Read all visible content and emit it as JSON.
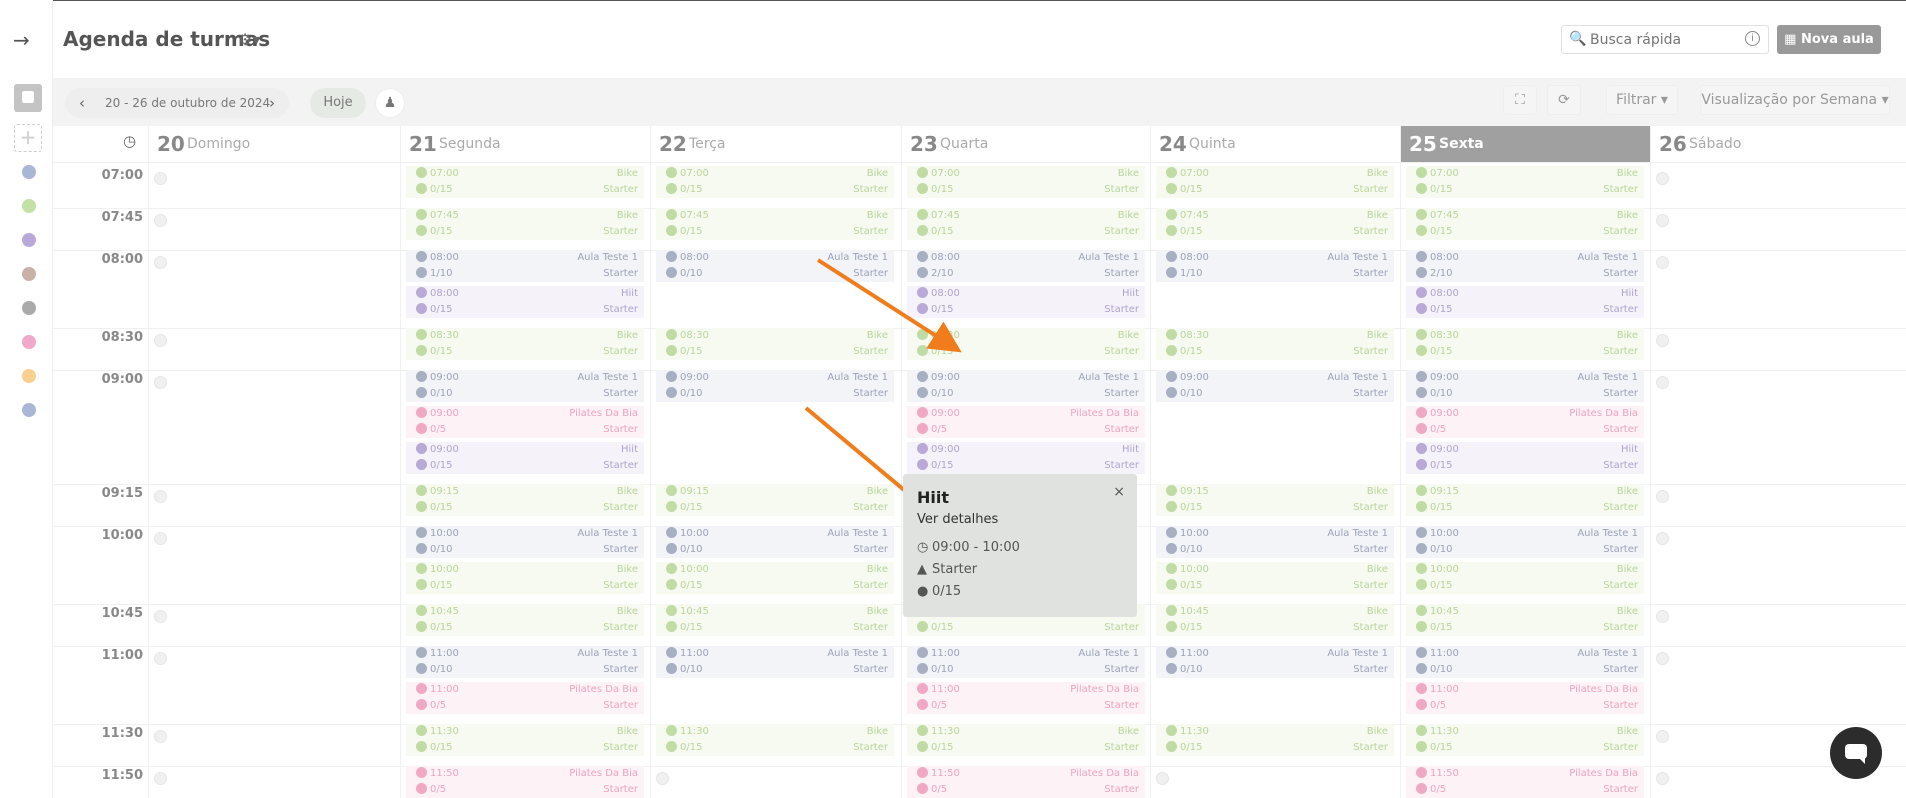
{
  "header": {
    "title": "Agenda de turmas",
    "search_placeholder": "Busca rápida",
    "new_class": "Nova aula"
  },
  "toolbar": {
    "date_range": "20 - 26 de outubro de 2024",
    "today": "Hoje",
    "filter": "Filtrar",
    "view": "Visualização por Semana"
  },
  "sidebar": {
    "colors": [
      "#a9b6d6",
      "#c3e0a6",
      "#b9a9d9",
      "#c8b1a6",
      "#aaaaaa",
      "#f2a9c9",
      "#fbcf8e",
      "#a9b6d6"
    ]
  },
  "days": [
    {
      "num": "20",
      "name": "Domingo"
    },
    {
      "num": "21",
      "name": "Segunda"
    },
    {
      "num": "22",
      "name": "Terça"
    },
    {
      "num": "23",
      "name": "Quarta"
    },
    {
      "num": "24",
      "name": "Quinta"
    },
    {
      "num": "25",
      "name": "Sexta",
      "today": true
    },
    {
      "num": "26",
      "name": "Sábado"
    }
  ],
  "slots": [
    {
      "time": "07:00",
      "cells": [
        [],
        [
          [
            "07:00",
            "0/15",
            "Bike",
            "Starter",
            "green"
          ]
        ],
        [
          [
            "07:00",
            "0/15",
            "Bike",
            "Starter",
            "green"
          ]
        ],
        [
          [
            "07:00",
            "0/15",
            "Bike",
            "Starter",
            "green"
          ]
        ],
        [
          [
            "07:00",
            "0/15",
            "Bike",
            "Starter",
            "green"
          ]
        ],
        [
          [
            "07:00",
            "0/15",
            "Bike",
            "Starter",
            "green"
          ]
        ],
        []
      ]
    },
    {
      "time": "07:45",
      "cells": [
        [],
        [
          [
            "07:45",
            "0/15",
            "Bike",
            "Starter",
            "green"
          ]
        ],
        [
          [
            "07:45",
            "0/15",
            "Bike",
            "Starter",
            "green"
          ]
        ],
        [
          [
            "07:45",
            "0/15",
            "Bike",
            "Starter",
            "green"
          ]
        ],
        [
          [
            "07:45",
            "0/15",
            "Bike",
            "Starter",
            "green"
          ]
        ],
        [
          [
            "07:45",
            "0/15",
            "Bike",
            "Starter",
            "green"
          ]
        ],
        []
      ]
    },
    {
      "time": "08:00",
      "cells": [
        [],
        [
          [
            "08:00",
            "1/10",
            "Aula Teste 1",
            "Starter",
            "blue"
          ],
          [
            "08:00",
            "0/15",
            "Hiit",
            "Starter",
            "purple"
          ]
        ],
        [
          [
            "08:00",
            "0/10",
            "Aula Teste 1",
            "Starter",
            "blue"
          ]
        ],
        [
          [
            "08:00",
            "2/10",
            "Aula Teste 1",
            "Starter",
            "blue"
          ],
          [
            "08:00",
            "0/15",
            "Hiit",
            "Starter",
            "purple"
          ]
        ],
        [
          [
            "08:00",
            "1/10",
            "Aula Teste 1",
            "Starter",
            "blue"
          ]
        ],
        [
          [
            "08:00",
            "2/10",
            "Aula Teste 1",
            "Starter",
            "blue"
          ],
          [
            "08:00",
            "0/15",
            "Hiit",
            "Starter",
            "purple"
          ]
        ],
        []
      ]
    },
    {
      "time": "08:30",
      "cells": [
        [],
        [
          [
            "08:30",
            "0/15",
            "Bike",
            "Starter",
            "green"
          ]
        ],
        [
          [
            "08:30",
            "0/15",
            "Bike",
            "Starter",
            "green"
          ]
        ],
        [
          [
            "08:30",
            "0/15",
            "Bike",
            "Starter",
            "green"
          ]
        ],
        [
          [
            "08:30",
            "0/15",
            "Bike",
            "Starter",
            "green"
          ]
        ],
        [
          [
            "08:30",
            "0/15",
            "Bike",
            "Starter",
            "green"
          ]
        ],
        []
      ]
    },
    {
      "time": "09:00",
      "cells": [
        [],
        [
          [
            "09:00",
            "0/10",
            "Aula Teste 1",
            "Starter",
            "blue"
          ],
          [
            "09:00",
            "0/5",
            "Pilates Da Bia",
            "Starter",
            "pink"
          ],
          [
            "09:00",
            "0/15",
            "Hiit",
            "Starter",
            "purple"
          ]
        ],
        [
          [
            "09:00",
            "0/10",
            "Aula Teste 1",
            "Starter",
            "blue"
          ]
        ],
        [
          [
            "09:00",
            "0/10",
            "Aula Teste 1",
            "Starter",
            "blue"
          ],
          [
            "09:00",
            "0/5",
            "Pilates Da Bia",
            "Starter",
            "pink"
          ],
          [
            "09:00",
            "0/15",
            "Hiit",
            "Starter",
            "purple"
          ]
        ],
        [
          [
            "09:00",
            "0/10",
            "Aula Teste 1",
            "Starter",
            "blue"
          ]
        ],
        [
          [
            "09:00",
            "0/10",
            "Aula Teste 1",
            "Starter",
            "blue"
          ],
          [
            "09:00",
            "0/5",
            "Pilates Da Bia",
            "Starter",
            "pink"
          ],
          [
            "09:00",
            "0/15",
            "Hiit",
            "Starter",
            "purple"
          ]
        ],
        []
      ]
    },
    {
      "time": "09:15",
      "cells": [
        [],
        [
          [
            "09:15",
            "0/15",
            "Bike",
            "Starter",
            "green"
          ]
        ],
        [
          [
            "09:15",
            "0/15",
            "Bike",
            "Starter",
            "green"
          ]
        ],
        [],
        [
          [
            "09:15",
            "0/15",
            "Bike",
            "Starter",
            "green"
          ]
        ],
        [
          [
            "09:15",
            "0/15",
            "Bike",
            "Starter",
            "green"
          ]
        ],
        []
      ]
    },
    {
      "time": "10:00",
      "cells": [
        [],
        [
          [
            "10:00",
            "0/10",
            "Aula Teste 1",
            "Starter",
            "blue"
          ],
          [
            "10:00",
            "0/15",
            "Bike",
            "Starter",
            "green"
          ]
        ],
        [
          [
            "10:00",
            "0/10",
            "Aula Teste 1",
            "Starter",
            "blue"
          ],
          [
            "10:00",
            "0/15",
            "Bike",
            "Starter",
            "green"
          ]
        ],
        [],
        [
          [
            "10:00",
            "0/10",
            "Aula Teste 1",
            "Starter",
            "blue"
          ],
          [
            "10:00",
            "0/15",
            "Bike",
            "Starter",
            "green"
          ]
        ],
        [
          [
            "10:00",
            "0/10",
            "Aula Teste 1",
            "Starter",
            "blue"
          ],
          [
            "10:00",
            "0/15",
            "Bike",
            "Starter",
            "green"
          ]
        ],
        []
      ]
    },
    {
      "time": "10:45",
      "cells": [
        [],
        [
          [
            "10:45",
            "0/15",
            "Bike",
            "Starter",
            "green"
          ]
        ],
        [
          [
            "10:45",
            "0/15",
            "Bike",
            "Starter",
            "green"
          ]
        ],
        [
          [
            "",
            "0/15",
            "",
            "Starter",
            "green"
          ]
        ],
        [
          [
            "10:45",
            "0/15",
            "Bike",
            "Starter",
            "green"
          ]
        ],
        [
          [
            "10:45",
            "0/15",
            "Bike",
            "Starter",
            "green"
          ]
        ],
        []
      ]
    },
    {
      "time": "11:00",
      "cells": [
        [],
        [
          [
            "11:00",
            "0/10",
            "Aula Teste 1",
            "Starter",
            "blue"
          ],
          [
            "11:00",
            "0/5",
            "Pilates Da Bia",
            "Starter",
            "pink"
          ]
        ],
        [
          [
            "11:00",
            "0/10",
            "Aula Teste 1",
            "Starter",
            "blue"
          ]
        ],
        [
          [
            "11:00",
            "0/10",
            "Aula Teste 1",
            "Starter",
            "blue"
          ],
          [
            "11:00",
            "0/5",
            "Pilates Da Bia",
            "Starter",
            "pink"
          ]
        ],
        [
          [
            "11:00",
            "0/10",
            "Aula Teste 1",
            "Starter",
            "blue"
          ]
        ],
        [
          [
            "11:00",
            "0/10",
            "Aula Teste 1",
            "Starter",
            "blue"
          ],
          [
            "11:00",
            "0/5",
            "Pilates Da Bia",
            "Starter",
            "pink"
          ]
        ],
        []
      ]
    },
    {
      "time": "11:30",
      "cells": [
        [],
        [
          [
            "11:30",
            "0/15",
            "Bike",
            "Starter",
            "green"
          ]
        ],
        [
          [
            "11:30",
            "0/15",
            "Bike",
            "Starter",
            "green"
          ]
        ],
        [
          [
            "11:30",
            "0/15",
            "Bike",
            "Starter",
            "green"
          ]
        ],
        [
          [
            "11:30",
            "0/15",
            "Bike",
            "Starter",
            "green"
          ]
        ],
        [
          [
            "11:30",
            "0/15",
            "Bike",
            "Starter",
            "green"
          ]
        ],
        []
      ]
    },
    {
      "time": "11:50",
      "cells": [
        [],
        [
          [
            "11:50",
            "0/5",
            "Pilates Da Bia",
            "Starter",
            "pink"
          ]
        ],
        [],
        [
          [
            "11:50",
            "0/5",
            "Pilates Da Bia",
            "Starter",
            "pink"
          ]
        ],
        [],
        [
          [
            "11:50",
            "0/5",
            "Pilates Da Bia",
            "Starter",
            "pink"
          ]
        ],
        []
      ]
    }
  ],
  "popover": {
    "title": "Hiit",
    "details": "Ver detalhes",
    "time": "09:00 - 10:00",
    "level": "Starter",
    "capacity": "0/15"
  }
}
